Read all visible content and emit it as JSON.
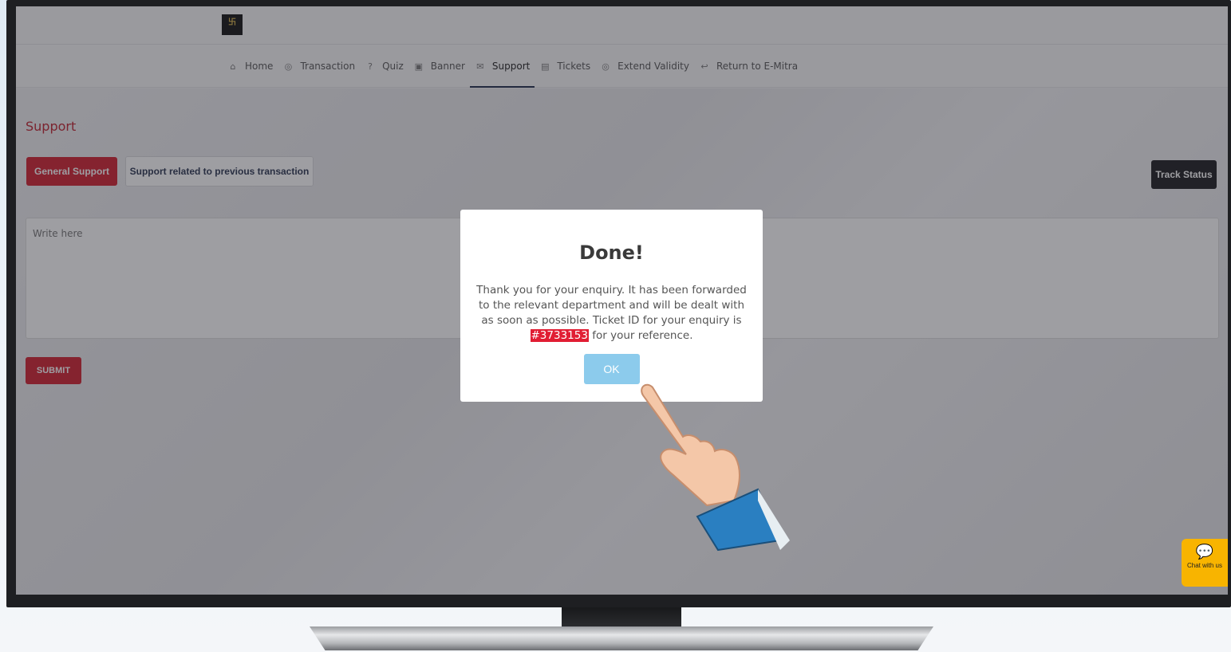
{
  "header": {
    "logo_text": "卐"
  },
  "nav": {
    "items": [
      {
        "label": "Home",
        "icon": "home-icon"
      },
      {
        "label": "Transaction",
        "icon": "transaction-icon"
      },
      {
        "label": "Quiz",
        "icon": "quiz-icon"
      },
      {
        "label": "Banner",
        "icon": "banner-icon"
      },
      {
        "label": "Support",
        "icon": "mail-icon",
        "active": true
      },
      {
        "label": "Tickets",
        "icon": "ticket-icon"
      },
      {
        "label": "Extend Validity",
        "icon": "extend-icon"
      },
      {
        "label": "Return to E-Mitra",
        "icon": "return-icon"
      }
    ]
  },
  "page": {
    "title": "Support",
    "tab_general": "General Support",
    "tab_previous": "Support related to previous transaction",
    "track_status": "Track Status",
    "textarea_placeholder": "Write here",
    "submit": "SUBMIT"
  },
  "modal": {
    "title": "Done!",
    "text_before": "Thank you for your enquiry. It has been forwarded to the relevant department and will be dealt with as soon as possible. Ticket ID for your enquiry is",
    "ticket_id": "#3733153",
    "text_after": "for your reference.",
    "ok": "OK"
  },
  "chat": {
    "label": "Chat with us"
  },
  "colors": {
    "accent": "#d21f2f",
    "ok_button": "#8ccbec",
    "chat": "#f8b400"
  }
}
